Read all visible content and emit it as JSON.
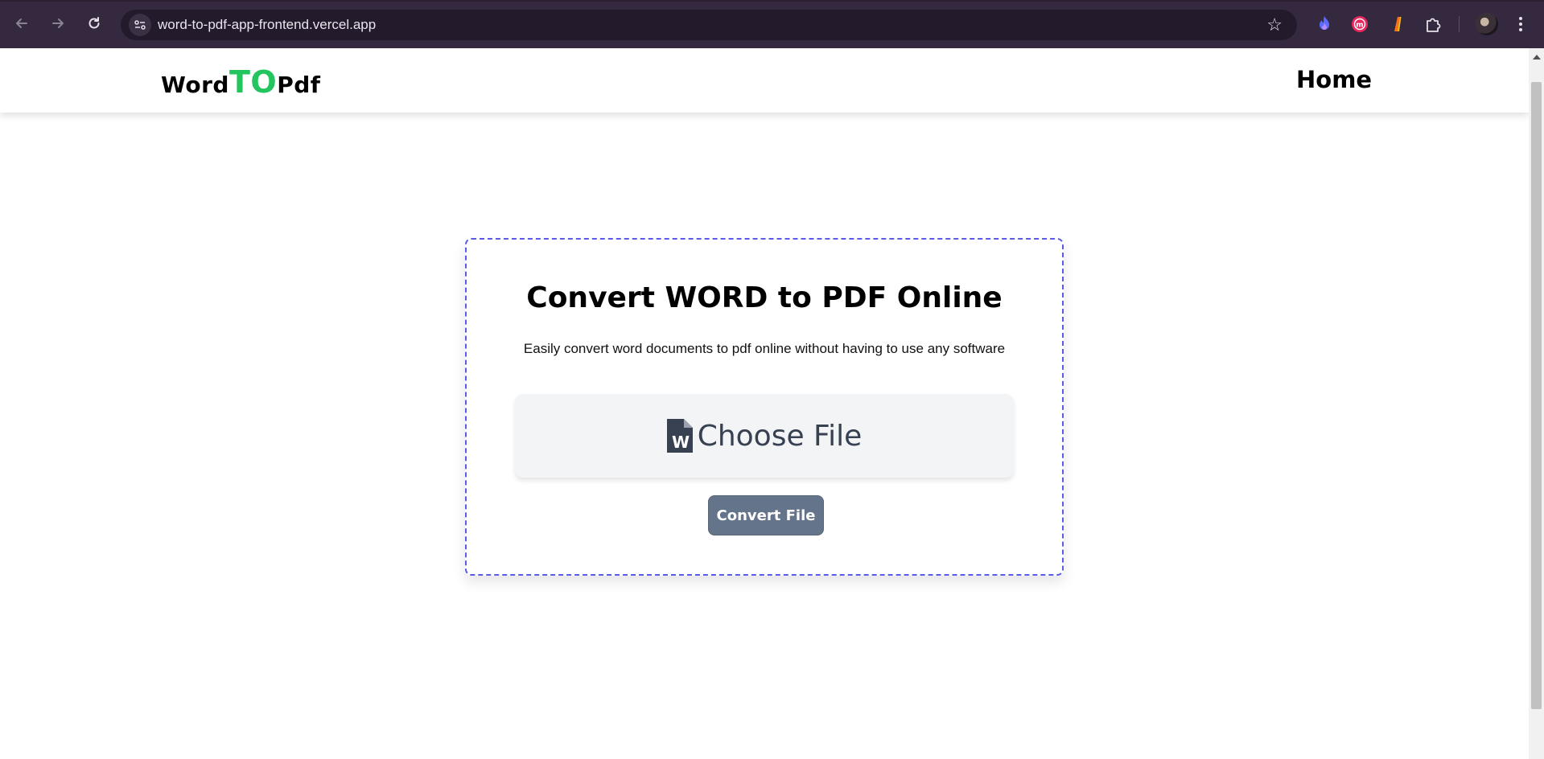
{
  "browser": {
    "url": "word-to-pdf-app-frontend.vercel.app",
    "icons": [
      "back-arrow-icon",
      "forward-arrow-icon",
      "reload-icon",
      "site-info-icon",
      "bookmark-star-icon",
      "extension-flame-icon",
      "extension-m-icon",
      "extension-lamp-icon",
      "extensions-puzzle-icon",
      "profile-avatar",
      "more-menu-icon"
    ]
  },
  "navbar": {
    "logo_word": "Word",
    "logo_to": "TO",
    "logo_pdf": "Pdf",
    "home_label": "Home"
  },
  "card": {
    "title": "Convert WORD to PDF Online",
    "subtitle": "Easily convert word documents to pdf online without having to use any software",
    "choose_file_label": "Choose File",
    "convert_label": "Convert File"
  },
  "colors": {
    "accent_green": "#22c55e",
    "card_border": "#5b5be6",
    "button_bg": "#64748b",
    "chrome_bg": "#35293f"
  }
}
